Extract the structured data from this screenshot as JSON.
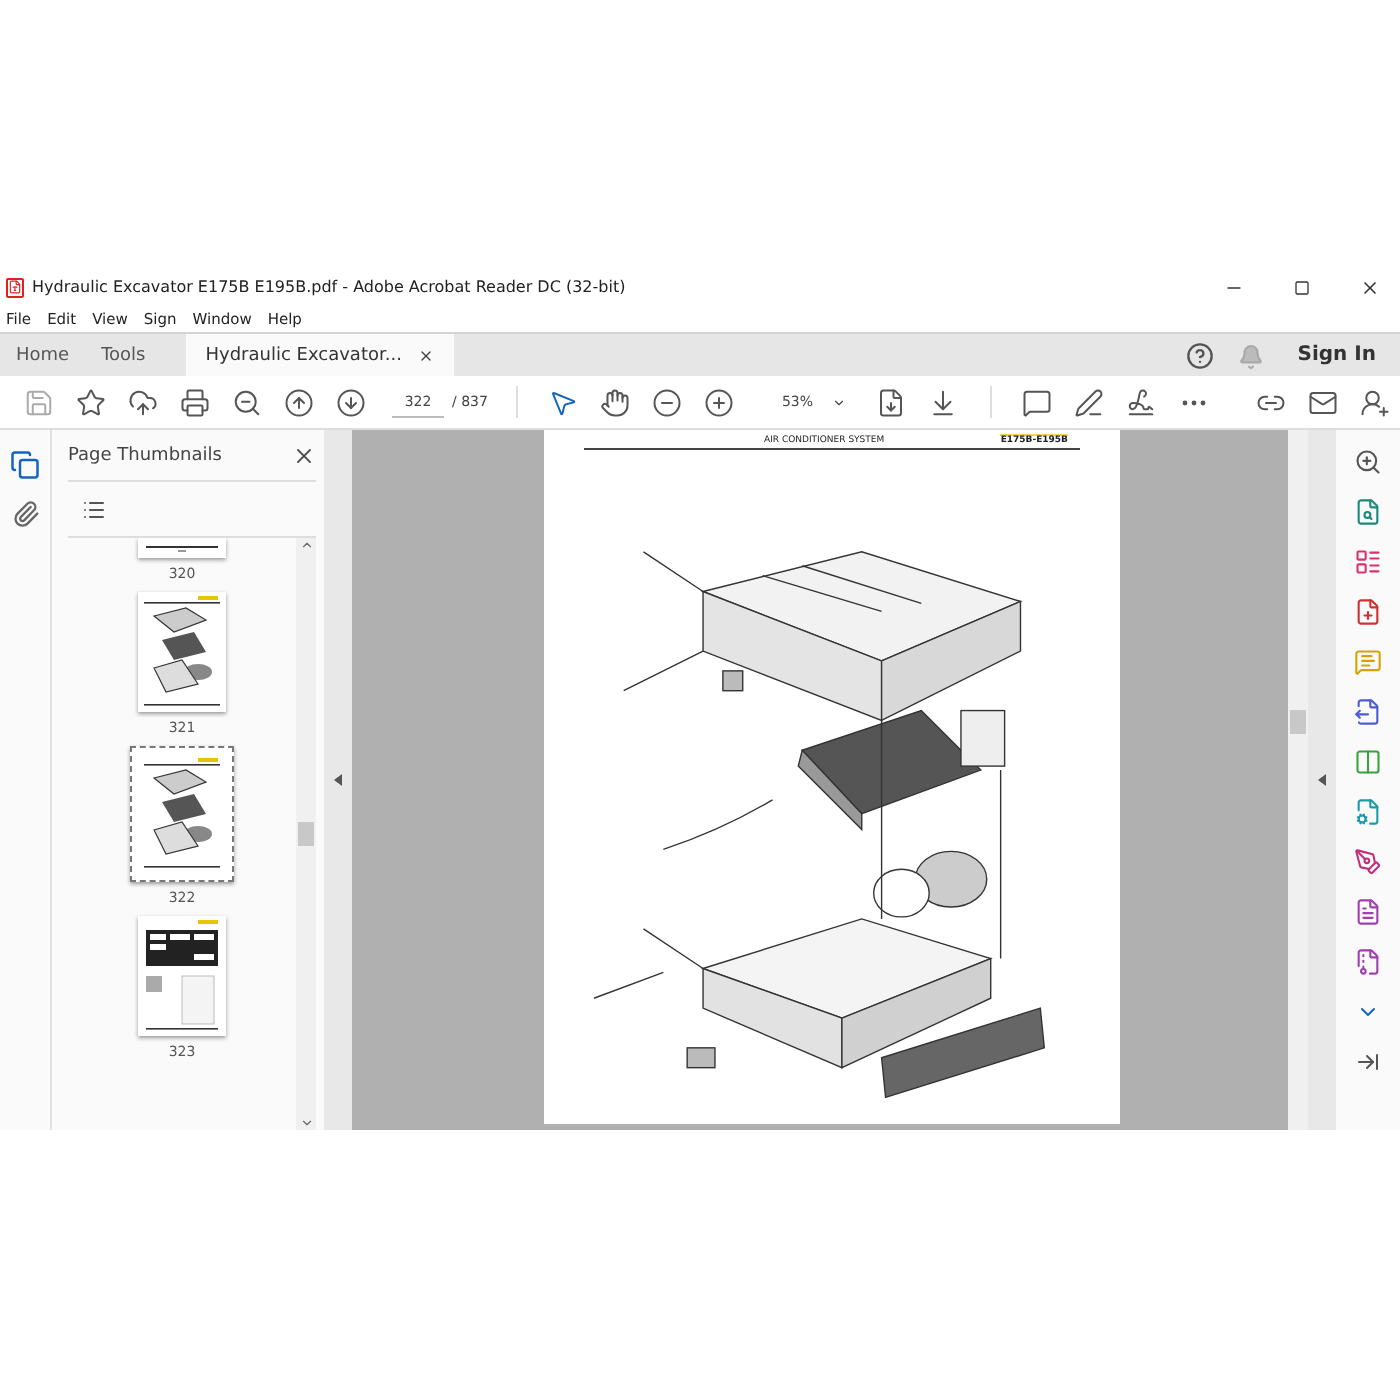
{
  "window": {
    "title": "Hydraulic Excavator E175B E195B.pdf - Adobe Acrobat Reader DC (32-bit)"
  },
  "menu": [
    "File",
    "Edit",
    "View",
    "Sign",
    "Window",
    "Help"
  ],
  "tabs": [
    {
      "label": "Home",
      "selected": false
    },
    {
      "label": "Tools",
      "selected": false
    },
    {
      "label": "Hydraulic Excavator...",
      "selected": true
    }
  ],
  "account": {
    "sign_in": "Sign In"
  },
  "toolbar": {
    "page": "322",
    "total": "/ 837",
    "zoom": "53%"
  },
  "panel": {
    "title": "Page Thumbnails",
    "thumbnails": [
      {
        "label": "320",
        "kind": "cut",
        "selected": false
      },
      {
        "label": "321",
        "kind": "diagram",
        "selected": false
      },
      {
        "label": "322",
        "kind": "diagram",
        "selected": true
      },
      {
        "label": "323",
        "kind": "table",
        "selected": false
      }
    ]
  },
  "document": {
    "header": "AIR CONDITIONER SYSTEM",
    "model": "E175B-E195B"
  }
}
